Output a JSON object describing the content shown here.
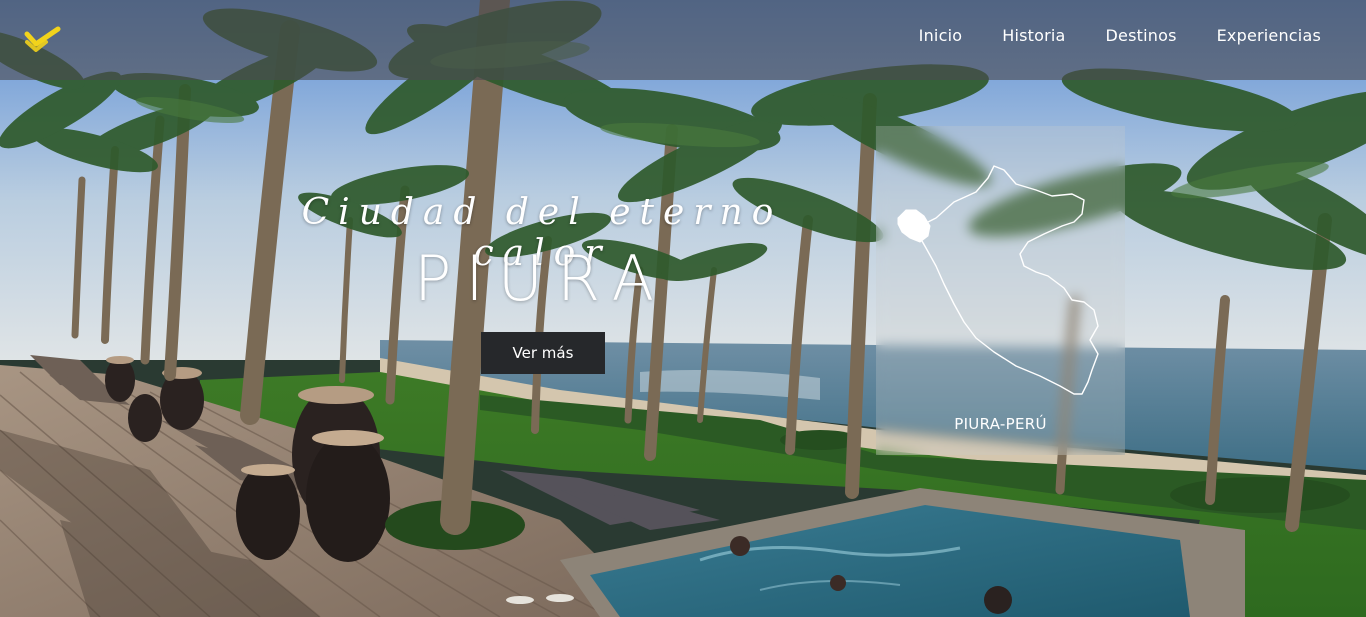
{
  "header": {
    "logo_icon": "check-chevron-logo",
    "accent_color": "#f2d31b",
    "nav": [
      {
        "label": "Inicio"
      },
      {
        "label": "Historia"
      },
      {
        "label": "Destinos"
      },
      {
        "label": "Experiencias"
      }
    ]
  },
  "hero": {
    "subtitle": "Ciudad del eterno calor",
    "title": "PIURA",
    "cta_label": "Ver más"
  },
  "map_card": {
    "label": "PIURA-PERÚ",
    "icon": "peru-map-outline-icon"
  }
}
